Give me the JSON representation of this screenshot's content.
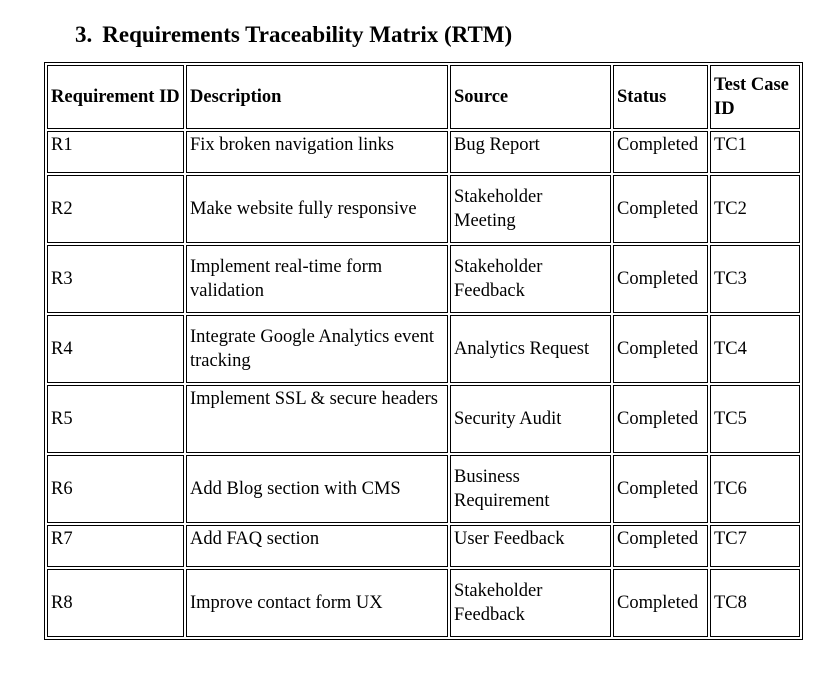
{
  "section": {
    "number": "3.",
    "title": "Requirements Traceability Matrix (RTM)"
  },
  "table": {
    "headers": [
      "Requirement ID",
      "Description",
      "Source",
      "Status",
      "Test Case ID"
    ],
    "rows": [
      [
        "R1",
        "Fix broken navigation links",
        "Bug Report",
        "Completed",
        "TC1"
      ],
      [
        "R2",
        "Make website fully responsive",
        "Stakeholder Meeting",
        "Completed",
        "TC2"
      ],
      [
        "R3",
        "Implement real-time form validation",
        "Stakeholder Feedback",
        "Completed",
        "TC3"
      ],
      [
        "R4",
        "Integrate Google Analytics event tracking",
        "Analytics Request",
        "Completed",
        "TC4"
      ],
      [
        "R5",
        "Implement SSL & secure headers",
        "Security Audit",
        "Completed",
        "TC5"
      ],
      [
        "R6",
        "Add Blog section with CMS",
        "Business Requirement",
        "Completed",
        "TC6"
      ],
      [
        "R7",
        "Add FAQ section",
        "User Feedback",
        "Completed",
        "TC7"
      ],
      [
        "R8",
        "Improve contact form UX",
        "Stakeholder Feedback",
        "Completed",
        "TC8"
      ]
    ]
  }
}
